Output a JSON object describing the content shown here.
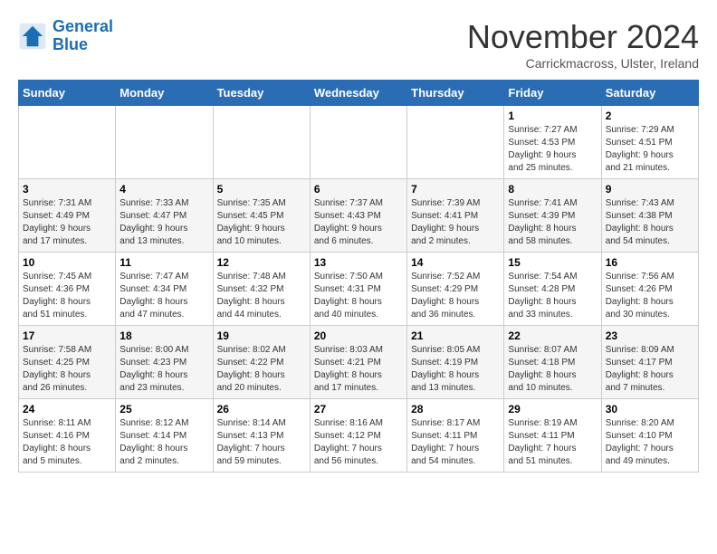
{
  "header": {
    "logo_line1": "General",
    "logo_line2": "Blue",
    "month_title": "November 2024",
    "subtitle": "Carrickmacross, Ulster, Ireland"
  },
  "weekdays": [
    "Sunday",
    "Monday",
    "Tuesday",
    "Wednesday",
    "Thursday",
    "Friday",
    "Saturday"
  ],
  "weeks": [
    [
      {
        "day": "",
        "info": ""
      },
      {
        "day": "",
        "info": ""
      },
      {
        "day": "",
        "info": ""
      },
      {
        "day": "",
        "info": ""
      },
      {
        "day": "",
        "info": ""
      },
      {
        "day": "1",
        "info": "Sunrise: 7:27 AM\nSunset: 4:53 PM\nDaylight: 9 hours\nand 25 minutes."
      },
      {
        "day": "2",
        "info": "Sunrise: 7:29 AM\nSunset: 4:51 PM\nDaylight: 9 hours\nand 21 minutes."
      }
    ],
    [
      {
        "day": "3",
        "info": "Sunrise: 7:31 AM\nSunset: 4:49 PM\nDaylight: 9 hours\nand 17 minutes."
      },
      {
        "day": "4",
        "info": "Sunrise: 7:33 AM\nSunset: 4:47 PM\nDaylight: 9 hours\nand 13 minutes."
      },
      {
        "day": "5",
        "info": "Sunrise: 7:35 AM\nSunset: 4:45 PM\nDaylight: 9 hours\nand 10 minutes."
      },
      {
        "day": "6",
        "info": "Sunrise: 7:37 AM\nSunset: 4:43 PM\nDaylight: 9 hours\nand 6 minutes."
      },
      {
        "day": "7",
        "info": "Sunrise: 7:39 AM\nSunset: 4:41 PM\nDaylight: 9 hours\nand 2 minutes."
      },
      {
        "day": "8",
        "info": "Sunrise: 7:41 AM\nSunset: 4:39 PM\nDaylight: 8 hours\nand 58 minutes."
      },
      {
        "day": "9",
        "info": "Sunrise: 7:43 AM\nSunset: 4:38 PM\nDaylight: 8 hours\nand 54 minutes."
      }
    ],
    [
      {
        "day": "10",
        "info": "Sunrise: 7:45 AM\nSunset: 4:36 PM\nDaylight: 8 hours\nand 51 minutes."
      },
      {
        "day": "11",
        "info": "Sunrise: 7:47 AM\nSunset: 4:34 PM\nDaylight: 8 hours\nand 47 minutes."
      },
      {
        "day": "12",
        "info": "Sunrise: 7:48 AM\nSunset: 4:32 PM\nDaylight: 8 hours\nand 44 minutes."
      },
      {
        "day": "13",
        "info": "Sunrise: 7:50 AM\nSunset: 4:31 PM\nDaylight: 8 hours\nand 40 minutes."
      },
      {
        "day": "14",
        "info": "Sunrise: 7:52 AM\nSunset: 4:29 PM\nDaylight: 8 hours\nand 36 minutes."
      },
      {
        "day": "15",
        "info": "Sunrise: 7:54 AM\nSunset: 4:28 PM\nDaylight: 8 hours\nand 33 minutes."
      },
      {
        "day": "16",
        "info": "Sunrise: 7:56 AM\nSunset: 4:26 PM\nDaylight: 8 hours\nand 30 minutes."
      }
    ],
    [
      {
        "day": "17",
        "info": "Sunrise: 7:58 AM\nSunset: 4:25 PM\nDaylight: 8 hours\nand 26 minutes."
      },
      {
        "day": "18",
        "info": "Sunrise: 8:00 AM\nSunset: 4:23 PM\nDaylight: 8 hours\nand 23 minutes."
      },
      {
        "day": "19",
        "info": "Sunrise: 8:02 AM\nSunset: 4:22 PM\nDaylight: 8 hours\nand 20 minutes."
      },
      {
        "day": "20",
        "info": "Sunrise: 8:03 AM\nSunset: 4:21 PM\nDaylight: 8 hours\nand 17 minutes."
      },
      {
        "day": "21",
        "info": "Sunrise: 8:05 AM\nSunset: 4:19 PM\nDaylight: 8 hours\nand 13 minutes."
      },
      {
        "day": "22",
        "info": "Sunrise: 8:07 AM\nSunset: 4:18 PM\nDaylight: 8 hours\nand 10 minutes."
      },
      {
        "day": "23",
        "info": "Sunrise: 8:09 AM\nSunset: 4:17 PM\nDaylight: 8 hours\nand 7 minutes."
      }
    ],
    [
      {
        "day": "24",
        "info": "Sunrise: 8:11 AM\nSunset: 4:16 PM\nDaylight: 8 hours\nand 5 minutes."
      },
      {
        "day": "25",
        "info": "Sunrise: 8:12 AM\nSunset: 4:14 PM\nDaylight: 8 hours\nand 2 minutes."
      },
      {
        "day": "26",
        "info": "Sunrise: 8:14 AM\nSunset: 4:13 PM\nDaylight: 7 hours\nand 59 minutes."
      },
      {
        "day": "27",
        "info": "Sunrise: 8:16 AM\nSunset: 4:12 PM\nDaylight: 7 hours\nand 56 minutes."
      },
      {
        "day": "28",
        "info": "Sunrise: 8:17 AM\nSunset: 4:11 PM\nDaylight: 7 hours\nand 54 minutes."
      },
      {
        "day": "29",
        "info": "Sunrise: 8:19 AM\nSunset: 4:11 PM\nDaylight: 7 hours\nand 51 minutes."
      },
      {
        "day": "30",
        "info": "Sunrise: 8:20 AM\nSunset: 4:10 PM\nDaylight: 7 hours\nand 49 minutes."
      }
    ]
  ]
}
